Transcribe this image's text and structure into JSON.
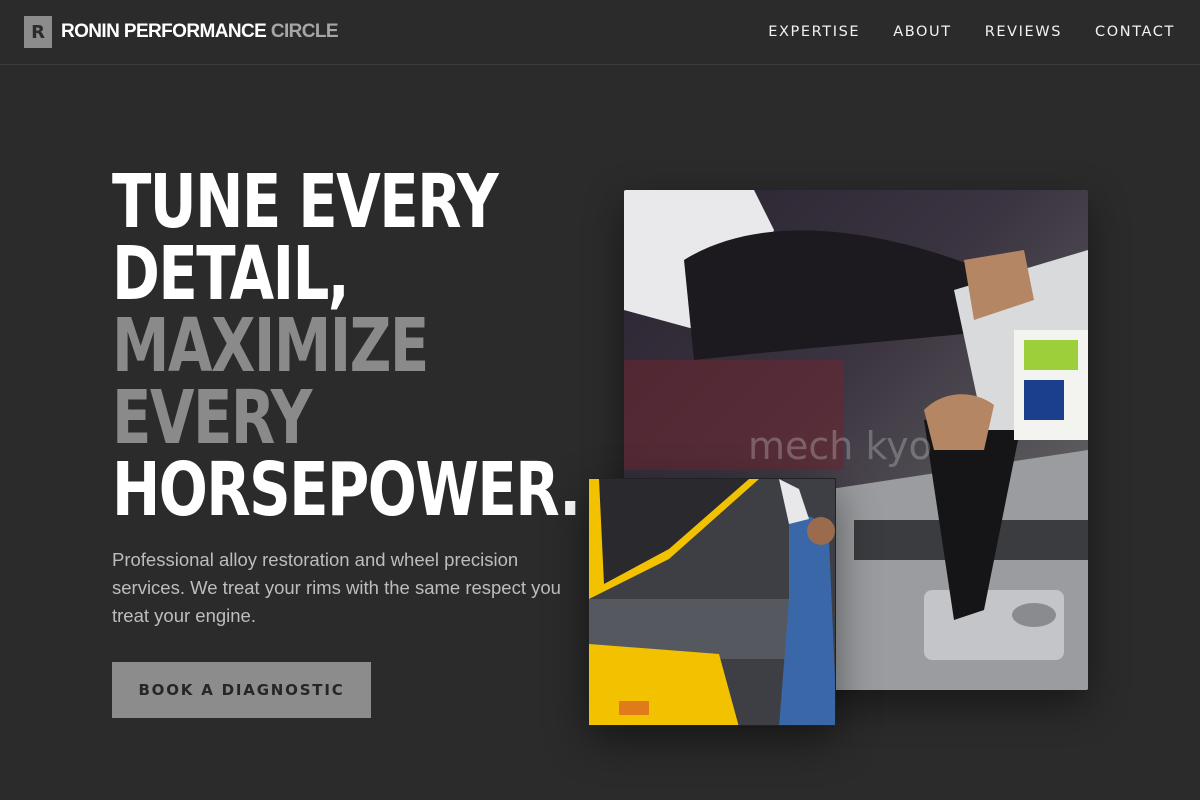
{
  "nav": {
    "logo_letter": "R",
    "brand_main": "RONIN PERFORMANCE",
    "brand_accent": "CIRCLE",
    "links": [
      "EXPERTISE",
      "ABOUT",
      "REVIEWS",
      "CONTACT"
    ]
  },
  "hero": {
    "title_lines": [
      {
        "text": "TUNE EVERY",
        "style": "white"
      },
      {
        "text": "DETAIL,",
        "style": "white"
      },
      {
        "text": "MAXIMIZE",
        "style": "muted"
      },
      {
        "text": "EVERY",
        "style": "muted"
      },
      {
        "text": "HORSEPOWER.",
        "style": "white"
      }
    ],
    "description": "Professional alloy restoration and wheel precision services. We treat your rims with the same respect you treat your engine.",
    "cta_label": "BOOK A DIAGNOSTIC"
  },
  "gallery": {
    "main_image_watermark": "mech  kyo",
    "colors": {
      "background": "#2b2b2b",
      "accent_gray": "#8c8c8c",
      "yellow_car": "#f2c200"
    }
  }
}
